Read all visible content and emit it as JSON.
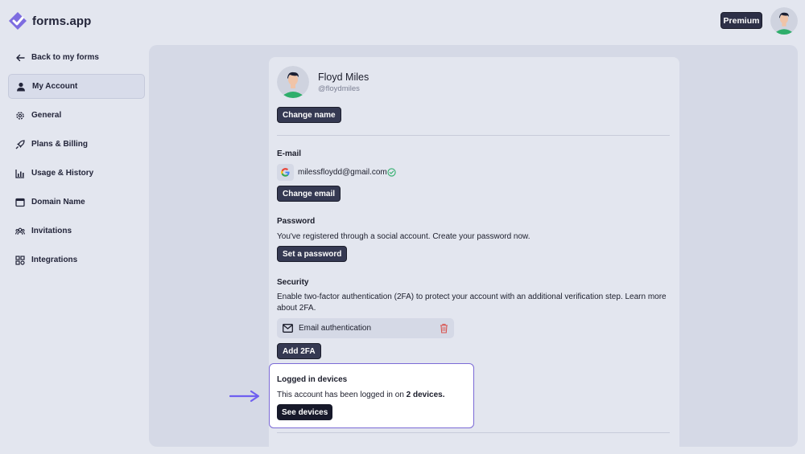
{
  "header": {
    "logo_text": "forms.app",
    "premium_label": "Premium"
  },
  "sidebar": {
    "back_label": "Back to my forms",
    "items": [
      {
        "label": "My Account",
        "icon": "user-icon",
        "active": true
      },
      {
        "label": "General",
        "icon": "gear-icon"
      },
      {
        "label": "Plans & Billing",
        "icon": "rocket-icon"
      },
      {
        "label": "Usage & History",
        "icon": "bar-chart-icon"
      },
      {
        "label": "Domain Name",
        "icon": "window-icon"
      },
      {
        "label": "Invitations",
        "icon": "users-icon"
      },
      {
        "label": "Integrations",
        "icon": "grid-icon"
      }
    ]
  },
  "profile": {
    "name": "Floyd Miles",
    "handle": "@floydmiles",
    "change_name_label": "Change name"
  },
  "email": {
    "title": "E-mail",
    "address": "milessfloydd@gmail.com",
    "change_email_label": "Change email"
  },
  "password": {
    "title": "Password",
    "description": "You've registered through a social account. Create your password now.",
    "set_password_label": "Set a password"
  },
  "security": {
    "title": "Security",
    "description_line1": "Enable two-factor authentication (2FA) to protect your account with an additional verification step. Learn more",
    "description_line2": "about 2FA.",
    "auth_method_label": "Email authentication",
    "add_2fa_label": "Add 2FA"
  },
  "devices": {
    "title": "Logged in devices",
    "text_prefix": "This account has been logged in on",
    "text_count": "2 devices.",
    "see_devices_label": "See devices"
  },
  "colors": {
    "background": "#e3e6ef",
    "panel": "#d5d9e6",
    "button_dark": "#353952",
    "highlight_border": "#7b6ad6",
    "arrow": "#6f5ff0",
    "avatar_shirt": "#2fae6b"
  }
}
